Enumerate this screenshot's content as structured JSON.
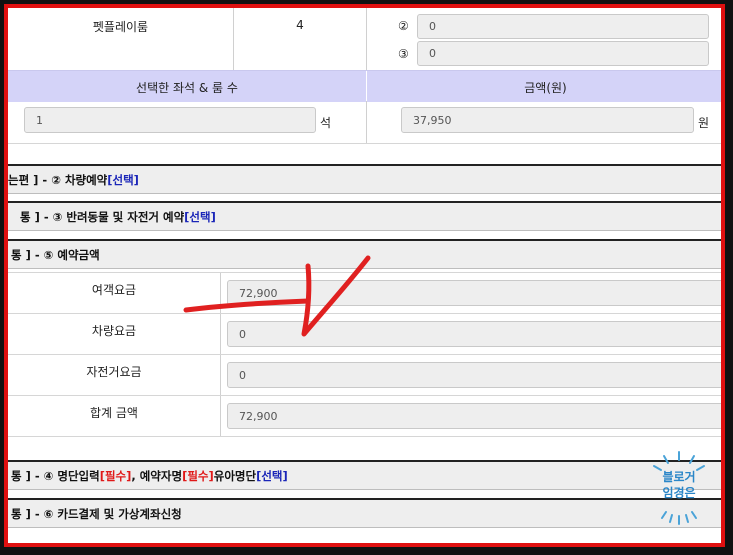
{
  "top_row": {
    "pet_label": "펫플레이룸",
    "pet_count": "4",
    "room_2_marker": "②",
    "room_2_value": "0",
    "room_3_marker": "③",
    "room_3_value": "0"
  },
  "summary_header": {
    "seat_col": "선택한 좌석 & 룸 수",
    "amount_col": "금액(원)"
  },
  "summary_row": {
    "seat_value": "1",
    "seat_unit": "석",
    "amount_value": "37,950",
    "amount_unit": "원"
  },
  "sections": {
    "vehicle": {
      "prefix": "는편 ] - ② 차량예약 ",
      "link": "[선택]"
    },
    "pet_bike": {
      "prefix": "통 ] - ③ 반려동물 및 자전거 예약 ",
      "link": "[선택]"
    },
    "fare": {
      "prefix": "통 ] - ⑤ 예약금액"
    },
    "roster": {
      "prefix": "통 ] - ④ 명단입력",
      "req1": "[필수]",
      "mid": ", 예약자명",
      "req2": "[필수]",
      "tail": "유아명단 ",
      "link": "[선택]"
    },
    "payment": {
      "prefix": "통 ] - ⑥ 카드결제 및 가상계좌신청"
    }
  },
  "fare_rows": [
    {
      "label": "여객요금",
      "value": "72,900"
    },
    {
      "label": "차량요금",
      "value": "0"
    },
    {
      "label": "자전거요금",
      "value": "0"
    },
    {
      "label": "합계 금액",
      "value": "72,900"
    }
  ],
  "watermark": {
    "line1": "블로거",
    "line2": "임경은"
  },
  "colors": {
    "frame": "#e01010",
    "header_bg": "#d4d3f8",
    "select_link": "#1b26b8",
    "required": "#e01818",
    "annotation": "#e02020"
  }
}
